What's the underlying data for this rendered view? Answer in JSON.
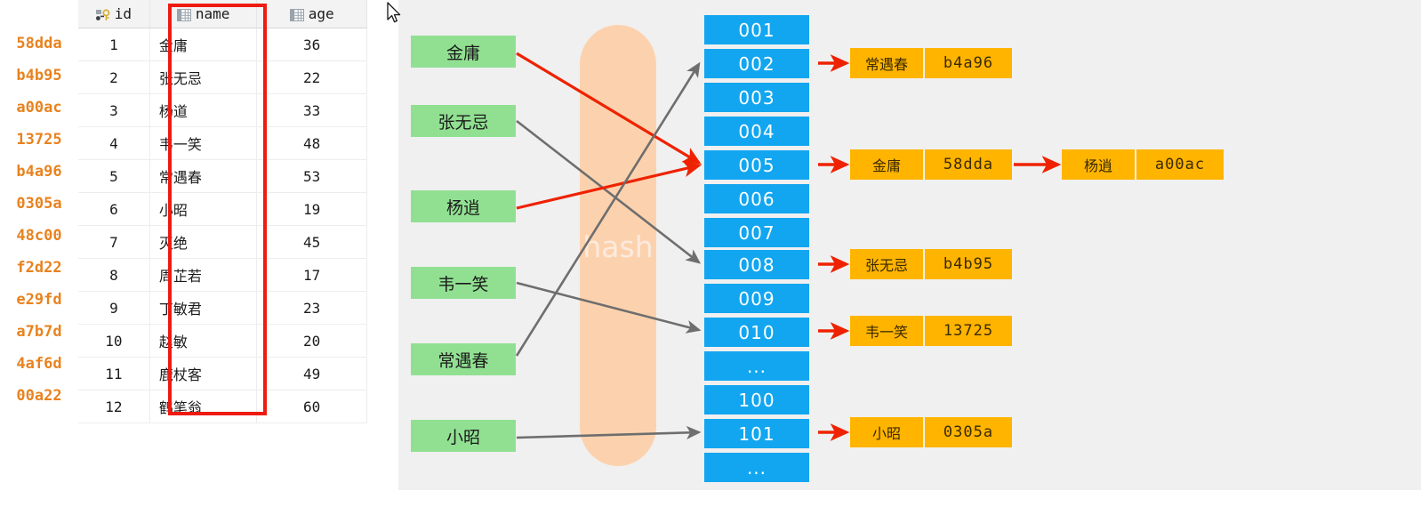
{
  "table": {
    "columns": [
      {
        "label": "id",
        "icon": "primary-key-icon"
      },
      {
        "label": "name",
        "icon": "column-grid-icon"
      },
      {
        "label": "age",
        "icon": "column-grid-icon"
      }
    ],
    "highlight_column": "name",
    "highlight_color": "#ee1b11",
    "hash_color": "#e8821e",
    "rows": [
      {
        "hash": "58dda",
        "id": "1",
        "name": "金庸",
        "age": "36"
      },
      {
        "hash": "b4b95",
        "id": "2",
        "name": "张无忌",
        "age": "22"
      },
      {
        "hash": "a00ac",
        "id": "3",
        "name": "杨道",
        "age": "33"
      },
      {
        "hash": "13725",
        "id": "4",
        "name": "韦一笑",
        "age": "48"
      },
      {
        "hash": "b4a96",
        "id": "5",
        "name": "常遇春",
        "age": "53"
      },
      {
        "hash": "0305a",
        "id": "6",
        "name": "小昭",
        "age": "19"
      },
      {
        "hash": "48c00",
        "id": "7",
        "name": "灭绝",
        "age": "45"
      },
      {
        "hash": "f2d22",
        "id": "8",
        "name": "周芷若",
        "age": "17"
      },
      {
        "hash": "e29fd",
        "id": "9",
        "name": "丁敏君",
        "age": "23"
      },
      {
        "hash": "a7b7d",
        "id": "10",
        "name": "赵敏",
        "age": "20"
      },
      {
        "hash": "4af6d",
        "id": "11",
        "name": "鹿杖客",
        "age": "49"
      },
      {
        "hash": "00a22",
        "id": "12",
        "name": "鹤笔翁",
        "age": "60"
      }
    ]
  },
  "diagram": {
    "background": "#f0f0f0",
    "hash_label": "hash",
    "hash_blob_color": "#fcd2ae",
    "key_color": "#91e092",
    "bucket_color": "#12a6f0",
    "entry_color": "#ffb400",
    "red_arrow_color": "#ee2200",
    "gray_arrow_color": "#6e6e6e",
    "keys": [
      {
        "label": "金庸",
        "arrow": "red",
        "target": "005"
      },
      {
        "label": "张无忌",
        "arrow": "gray",
        "target": "008"
      },
      {
        "label": "杨逍",
        "arrow": "red",
        "target": "005"
      },
      {
        "label": "韦一笑",
        "arrow": "gray",
        "target": "010"
      },
      {
        "label": "常遇春",
        "arrow": "gray",
        "target": "002"
      },
      {
        "label": "小昭",
        "arrow": "gray",
        "target": "101"
      }
    ],
    "buckets": [
      {
        "label": "001"
      },
      {
        "label": "002"
      },
      {
        "label": "003"
      },
      {
        "label": "004"
      },
      {
        "label": "005"
      },
      {
        "label": "006"
      },
      {
        "label": "007"
      },
      {
        "label": "008"
      },
      {
        "label": "009"
      },
      {
        "label": "010"
      },
      {
        "label": "..."
      },
      {
        "label": "100"
      },
      {
        "label": "101"
      },
      {
        "label": "..."
      }
    ],
    "chains": [
      {
        "bucket": "002",
        "nodes": [
          {
            "key": "常遇春",
            "value": "b4a96"
          }
        ]
      },
      {
        "bucket": "005",
        "nodes": [
          {
            "key": "金庸",
            "value": "58dda"
          },
          {
            "key": "杨逍",
            "value": "a00ac"
          }
        ]
      },
      {
        "bucket": "008",
        "nodes": [
          {
            "key": "张无忌",
            "value": "b4b95"
          }
        ]
      },
      {
        "bucket": "010",
        "nodes": [
          {
            "key": "韦一笑",
            "value": "13725"
          }
        ]
      },
      {
        "bucket": "101",
        "nodes": [
          {
            "key": "小昭",
            "value": "0305a"
          }
        ]
      }
    ]
  }
}
